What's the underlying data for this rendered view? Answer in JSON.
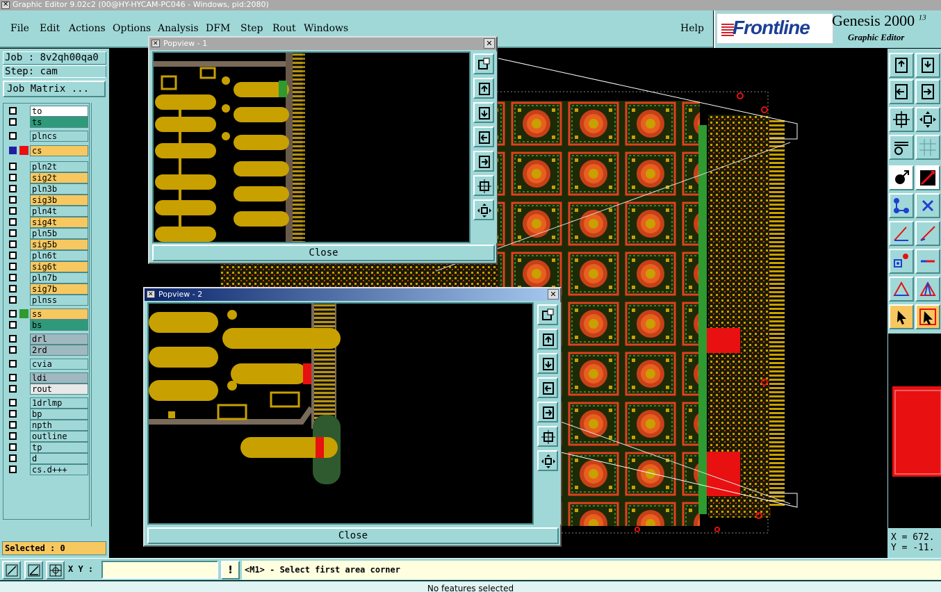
{
  "window": {
    "title": "Graphic Editor 9.02c2 (00@HY-HYCAM-PC046 - Windows, pid:2080)"
  },
  "menu": {
    "items": [
      "File",
      "Edit",
      "Actions",
      "Options",
      "Analysis",
      "DFM",
      "Step",
      "Rout",
      "Windows"
    ],
    "help": "Help"
  },
  "brand": {
    "logo": "Frontline",
    "product": "Genesis 2000",
    "version": "13",
    "subtitle": "Graphic Editor"
  },
  "job": {
    "label": "Job : 8v2qh00qa0",
    "step": "Step: cam",
    "matrix_button": "Job Matrix ..."
  },
  "layers": [
    {
      "name": "to",
      "color": "#ffffff"
    },
    {
      "name": "ts",
      "color": "#2f9a7a"
    },
    {
      "name": "plncs",
      "color": "#a0d8d8"
    },
    {
      "name": "cs",
      "color": "#f8c860",
      "active": true
    },
    {
      "name": "pln2t",
      "color": "#a0d8d8"
    },
    {
      "name": "sig2t",
      "color": "#f8c860"
    },
    {
      "name": "pln3b",
      "color": "#a0d8d8"
    },
    {
      "name": "sig3b",
      "color": "#f8c860"
    },
    {
      "name": "pln4t",
      "color": "#a0d8d8"
    },
    {
      "name": "sig4t",
      "color": "#f8c860"
    },
    {
      "name": "pln5b",
      "color": "#a0d8d8"
    },
    {
      "name": "sig5b",
      "color": "#f8c860"
    },
    {
      "name": "pln6t",
      "color": "#a0d8d8"
    },
    {
      "name": "sig6t",
      "color": "#f8c860"
    },
    {
      "name": "pln7b",
      "color": "#a0d8d8"
    },
    {
      "name": "sig7b",
      "color": "#f8c860"
    },
    {
      "name": "plnss",
      "color": "#a0d8d8"
    },
    {
      "name": "ss",
      "color": "#f8c860",
      "mark": "#2f9a2f"
    },
    {
      "name": "bs",
      "color": "#2f9a7a"
    },
    {
      "name": "drl",
      "color": "#a0b8c0"
    },
    {
      "name": "2rd",
      "color": "#a0b8c0"
    },
    {
      "name": "cvia",
      "color": "#a0d8d8"
    },
    {
      "name": "ldi",
      "color": "#a0b8c0"
    },
    {
      "name": "rout",
      "color": "#e8e8e8"
    },
    {
      "name": "1drlmp",
      "color": "#a0d8d8"
    },
    {
      "name": "bp",
      "color": "#a0d8d8"
    },
    {
      "name": "npth",
      "color": "#a0d8d8"
    },
    {
      "name": "outline",
      "color": "#a0d8d8"
    },
    {
      "name": "tp",
      "color": "#a0d8d8"
    },
    {
      "name": "d",
      "color": "#a0d8d8"
    },
    {
      "name": "cs.d+++",
      "color": "#a0d8d8"
    }
  ],
  "selected": "Selected : 0",
  "popview1": {
    "title": "Popview - 1",
    "close": "Close"
  },
  "popview2": {
    "title": "Popview - 2",
    "close": "Close"
  },
  "coords": {
    "x": "X = 672.",
    "y": "Y = -11."
  },
  "bottom": {
    "xy_label": "X Y :",
    "xy_value": "",
    "prompt": "<M1> - Select first area corner"
  },
  "status": "No features selected"
}
